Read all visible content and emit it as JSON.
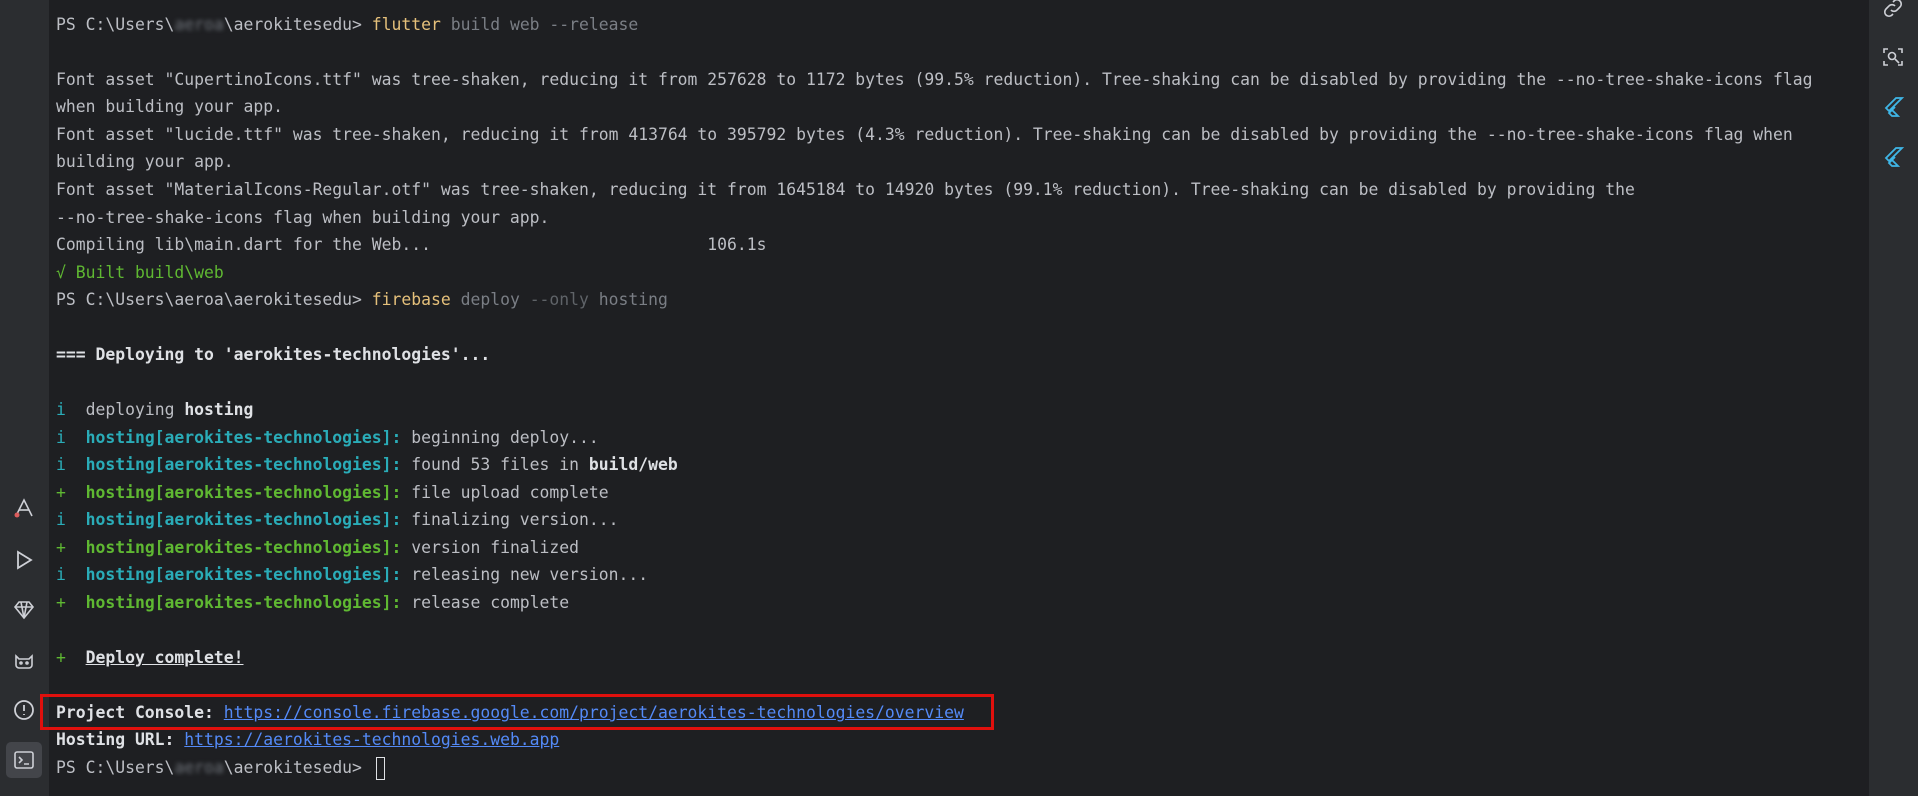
{
  "terminal": {
    "prompt1": {
      "prefix": "PS C:\\Users\\",
      "user": "aeroa",
      "suffix": "\\aerokitesedu> "
    },
    "cmd1": {
      "program": "flutter",
      "args": " build web --release"
    },
    "font1a": "Font asset \"CupertinoIcons.ttf\" was tree-shaken, reducing it from 257628 to 1172 bytes (99.5% reduction). Tree-shaking can be disabled by providing the --no-tree-shake-icons flag",
    "font1b": "when building your app.",
    "font2a": "Font asset \"lucide.ttf\" was tree-shaken, reducing it from 413764 to 395792 bytes (4.3% reduction). Tree-shaking can be disabled by providing the --no-tree-shake-icons flag when",
    "font2b": "building your app.",
    "font3a": "Font asset \"MaterialIcons-Regular.otf\" was tree-shaken, reducing it from 1645184 to 14920 bytes (99.1% reduction). Tree-shaking can be disabled by providing the",
    "font3b": "--no-tree-shake-icons flag when building your app.",
    "compiling": "Compiling lib\\main.dart for the Web...                            106.1s",
    "built": "√ Built build\\web",
    "prompt2": "PS C:\\Users\\aeroa\\aerokitesedu> ",
    "cmd2": {
      "program": "firebase",
      "arg1": " deploy ",
      "flag": "--only",
      "arg2": " hosting"
    },
    "deploying_prefix": "=== ",
    "deploying_text": "Deploying to 'aerokites-technologies'...",
    "log": [
      {
        "mark": "i",
        "label": "  ",
        "plain": "deploying ",
        "bold": "hosting",
        "color": "cyan"
      },
      {
        "mark": "i",
        "label": "  hosting[aerokites-technologies]:",
        "plain": " beginning deploy...",
        "bold": "",
        "color": "cyan"
      },
      {
        "mark": "i",
        "label": "  hosting[aerokites-technologies]:",
        "plain": " found 53 files in ",
        "bold": "build/web",
        "color": "cyan"
      },
      {
        "mark": "+",
        "label": "  hosting[aerokites-technologies]:",
        "plain": " file upload complete",
        "bold": "",
        "color": "green"
      },
      {
        "mark": "i",
        "label": "  hosting[aerokites-technologies]:",
        "plain": " finalizing version...",
        "bold": "",
        "color": "cyan"
      },
      {
        "mark": "+",
        "label": "  hosting[aerokites-technologies]:",
        "plain": " version finalized",
        "bold": "",
        "color": "green"
      },
      {
        "mark": "i",
        "label": "  hosting[aerokites-technologies]:",
        "plain": " releasing new version...",
        "bold": "",
        "color": "cyan"
      },
      {
        "mark": "+",
        "label": "  hosting[aerokites-technologies]:",
        "plain": " release complete",
        "bold": "",
        "color": "green"
      }
    ],
    "complete_mark": "+  ",
    "complete_text": "Deploy complete!",
    "console_label": "Project Console: ",
    "console_url": "https://console.firebase.google.com/project/aerokites-technologies/overview",
    "hosting_label": "Hosting URL: ",
    "hosting_url": "https://aerokites-technologies.web.app",
    "prompt3": {
      "prefix": "PS C:\\Users\\",
      "user": "aeroa",
      "suffix": "\\aerokitesedu> "
    }
  },
  "left_rail": {
    "icons": [
      "build-variants-icon",
      "run-icon",
      "gem-icon",
      "cat-icon",
      "problems-icon",
      "terminal-icon"
    ]
  },
  "right_rail": {
    "icons": [
      "link-icon",
      "inspect-icon",
      "flutter-icon",
      "flutter-outline-icon"
    ]
  },
  "colors": {
    "accent_link": "#548af7",
    "highlight_border": "#e0100d",
    "success": "#5fb832",
    "info": "#2aacb8"
  }
}
